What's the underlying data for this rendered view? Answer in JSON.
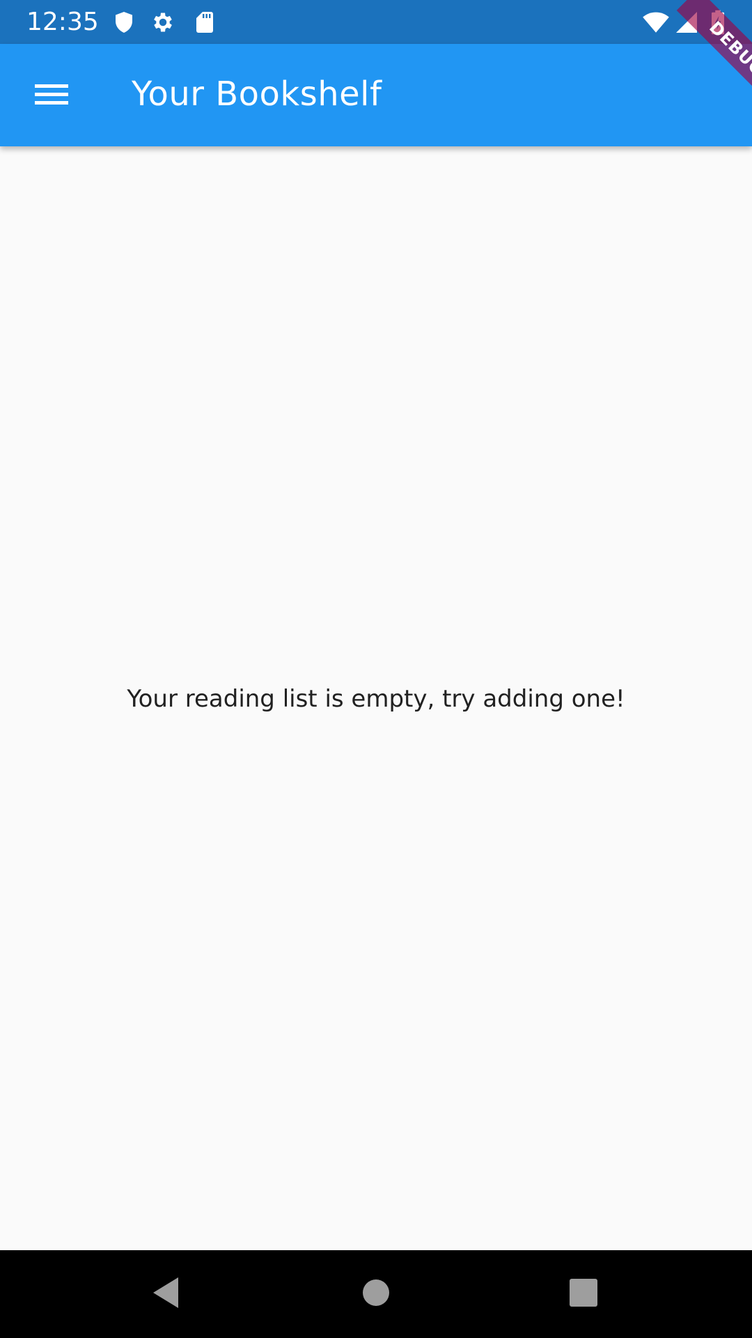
{
  "status_bar": {
    "time": "12:35",
    "left_icons": [
      "shield-icon",
      "gear-icon",
      "sd-card-icon"
    ],
    "right_icons": [
      "wifi-icon",
      "cell-signal-icon",
      "battery-charging-icon"
    ],
    "background": "#1b72bd"
  },
  "app_bar": {
    "title": "Your Bookshelf",
    "menu_icon": "menu-icon",
    "background": "#2196f3"
  },
  "debug_banner": {
    "label": "DEBUG"
  },
  "body": {
    "empty_message": "Your reading list is empty, try adding one!",
    "background": "#fafafa"
  },
  "nav_bar": {
    "buttons": [
      "back-icon",
      "home-icon",
      "recents-icon"
    ]
  }
}
